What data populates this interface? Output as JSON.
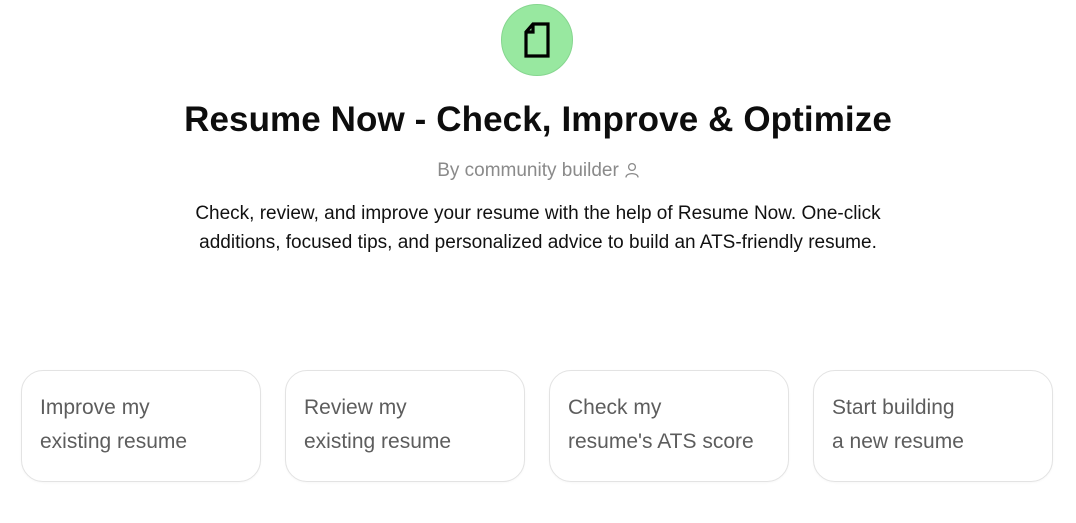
{
  "app": {
    "logo_icon": "document-icon",
    "logo_color": "#98e8a0",
    "title": "Resume Now - Check, Improve & Optimize",
    "byline": "By community builder",
    "byline_icon": "person-icon",
    "description": "Check, review, and improve your resume with the help of Resume Now. One-click additions, focused tips, and personalized advice to build an ATS-friendly resume."
  },
  "suggestions": [
    {
      "line1": "Improve my",
      "line2": "existing resume"
    },
    {
      "line1": "Review my",
      "line2": "existing resume"
    },
    {
      "line1": "Check my",
      "line2": "resume's ATS score"
    },
    {
      "line1": "Start building",
      "line2": "a new resume"
    }
  ]
}
